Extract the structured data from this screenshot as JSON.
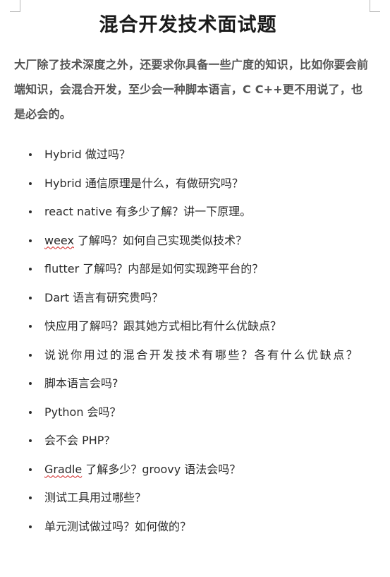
{
  "document": {
    "title": "混合开发技术面试题",
    "intro": "大厂除了技术深度之外，还要求你具备一些广度的知识，比如你要会前端知识，会混合开发，至少会一种脚本语言，C C++更不用说了，也是必会的。",
    "questions": [
      {
        "text": "Hybrid 做过吗？"
      },
      {
        "text": "Hybrid 通信原理是什么，有做研究吗？"
      },
      {
        "text": "react native 有多少了解？讲一下原理。"
      },
      {
        "flagged_word": "weex",
        "rest": " 了解吗？如何自己实现类似技术？"
      },
      {
        "text": "flutter 了解吗？内部是如何实现跨平台的？"
      },
      {
        "text": "Dart 语言有研究贵吗？"
      },
      {
        "text": "快应用了解吗？跟其她方式相比有什么优缺点？"
      },
      {
        "text": "说说你用过的混合开发技术有哪些？各有什么优缺点？"
      },
      {
        "text": "脚本语言会吗?"
      },
      {
        "text": "Python 会吗？"
      },
      {
        "text": "会不会 PHP?"
      },
      {
        "flagged_word": "Gradle",
        "rest": " 了解多少？groovy 语法会吗？"
      },
      {
        "text": "测试工具用过哪些？"
      },
      {
        "text": "单元测试做过吗？如何做的？"
      }
    ]
  }
}
